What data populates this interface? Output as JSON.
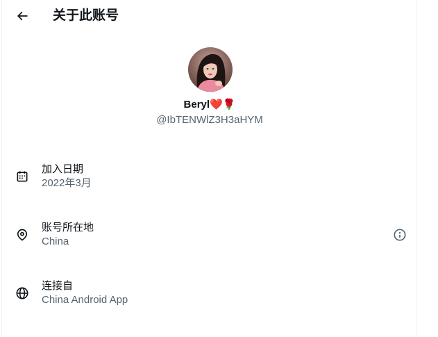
{
  "header": {
    "back_icon": "arrow-left-icon",
    "title": "关于此账号"
  },
  "profile": {
    "display_name": "Beryl❤️🌹",
    "handle": "@IbTENWlZ3H3aHYM"
  },
  "details": [
    {
      "icon": "calendar-icon",
      "label": "加入日期",
      "value": "2022年3月"
    },
    {
      "icon": "location-pin-icon",
      "label": "账号所在地",
      "value": "China"
    },
    {
      "icon": "globe-icon",
      "label": "连接自",
      "value": "China Android App"
    }
  ],
  "colors": {
    "text_primary": "#0f1419",
    "text_secondary": "#536471",
    "border": "#eff3f4"
  }
}
